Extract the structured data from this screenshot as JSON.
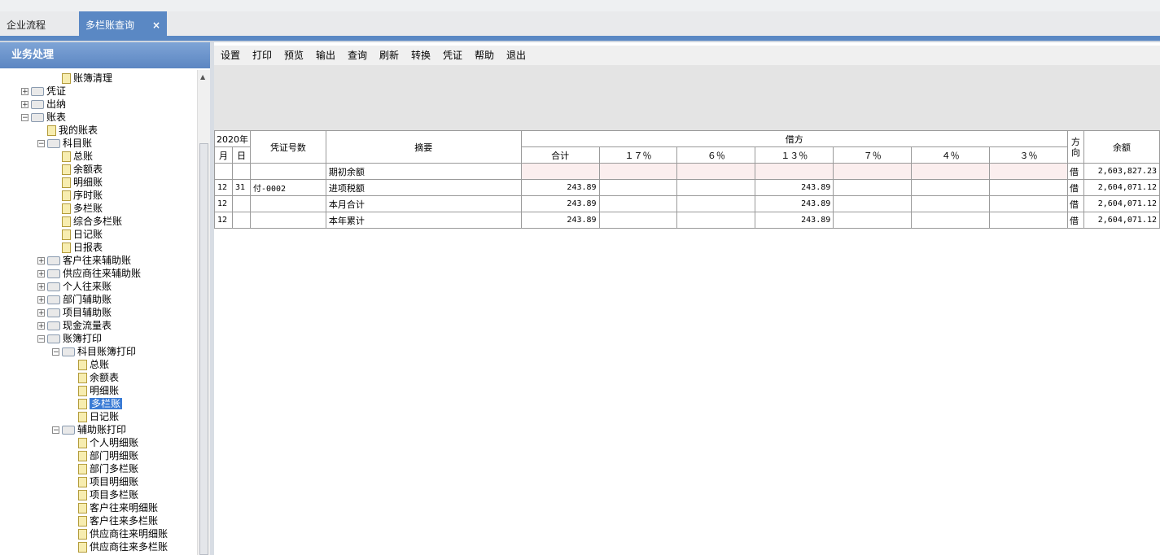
{
  "tabs": [
    {
      "label": "企业流程",
      "active": false
    },
    {
      "label": "多栏账查询",
      "active": true,
      "close": "×"
    }
  ],
  "left_panel": {
    "title": "业务处理",
    "tree": [
      {
        "label": "账簿清理",
        "type": "doc",
        "level": 3
      },
      {
        "label": "凭证",
        "type": "folder",
        "level": 1,
        "expander": "+"
      },
      {
        "label": "出纳",
        "type": "folder",
        "level": 1,
        "expander": "+"
      },
      {
        "label": "账表",
        "type": "folder",
        "level": 1,
        "expander": "−"
      },
      {
        "label": "我的账表",
        "type": "doc",
        "level": 2
      },
      {
        "label": "科目账",
        "type": "folder",
        "level": 2,
        "expander": "−"
      },
      {
        "label": "总账",
        "type": "doc",
        "level": 3
      },
      {
        "label": "余额表",
        "type": "doc",
        "level": 3
      },
      {
        "label": "明细账",
        "type": "doc",
        "level": 3
      },
      {
        "label": "序时账",
        "type": "doc",
        "level": 3
      },
      {
        "label": "多栏账",
        "type": "doc",
        "level": 3
      },
      {
        "label": "综合多栏账",
        "type": "doc",
        "level": 3
      },
      {
        "label": "日记账",
        "type": "doc",
        "level": 3
      },
      {
        "label": "日报表",
        "type": "doc",
        "level": 3
      },
      {
        "label": "客户往来辅助账",
        "type": "folder",
        "level": 2,
        "expander": "+"
      },
      {
        "label": "供应商往来辅助账",
        "type": "folder",
        "level": 2,
        "expander": "+"
      },
      {
        "label": "个人往来账",
        "type": "folder",
        "level": 2,
        "expander": "+"
      },
      {
        "label": "部门辅助账",
        "type": "folder",
        "level": 2,
        "expander": "+"
      },
      {
        "label": "项目辅助账",
        "type": "folder",
        "level": 2,
        "expander": "+"
      },
      {
        "label": "现金流量表",
        "type": "folder",
        "level": 2,
        "expander": "+"
      },
      {
        "label": "账簿打印",
        "type": "folder",
        "level": 2,
        "expander": "−"
      },
      {
        "label": "科目账簿打印",
        "type": "folder",
        "level": 3,
        "expander": "−"
      },
      {
        "label": "总账",
        "type": "doc",
        "level": 4
      },
      {
        "label": "余额表",
        "type": "doc",
        "level": 4
      },
      {
        "label": "明细账",
        "type": "doc",
        "level": 4
      },
      {
        "label": "多栏账",
        "type": "doc",
        "level": 4,
        "selected": true
      },
      {
        "label": "日记账",
        "type": "doc",
        "level": 4
      },
      {
        "label": "辅助账打印",
        "type": "folder",
        "level": 3,
        "expander": "−"
      },
      {
        "label": "个人明细账",
        "type": "doc",
        "level": 4
      },
      {
        "label": "部门明细账",
        "type": "doc",
        "level": 4
      },
      {
        "label": "部门多栏账",
        "type": "doc",
        "level": 4
      },
      {
        "label": "项目明细账",
        "type": "doc",
        "level": 4
      },
      {
        "label": "项目多栏账",
        "type": "doc",
        "level": 4
      },
      {
        "label": "客户往来明细账",
        "type": "doc",
        "level": 4
      },
      {
        "label": "客户往来多栏账",
        "type": "doc",
        "level": 4
      },
      {
        "label": "供应商往来明细账",
        "type": "doc",
        "level": 4
      },
      {
        "label": "供应商往来多栏账",
        "type": "doc",
        "level": 4
      }
    ]
  },
  "toolbar": [
    "设置",
    "打印",
    "预览",
    "输出",
    "查询",
    "刷新",
    "转换",
    "凭证",
    "帮助",
    "退出"
  ],
  "grid": {
    "year": "2020年",
    "month": "月",
    "day": "日",
    "voucher": "凭证号数",
    "summary": "摘要",
    "debit": "借方",
    "direction": "方向",
    "balance": "余额",
    "subcols": [
      "合计",
      "１７％",
      "６％",
      "１３％",
      "７％",
      "４％",
      "３％"
    ],
    "rows": [
      {
        "m": "",
        "d": "",
        "v": "",
        "s": "期初余额",
        "total": "",
        "c13": "",
        "dir": "借",
        "bal": "2,603,827.23"
      },
      {
        "m": "12",
        "d": "31",
        "v": "付-0002",
        "s": "进项税额",
        "total": "243.89",
        "c13": "243.89",
        "dir": "借",
        "bal": "2,604,071.12"
      },
      {
        "m": "12",
        "d": "",
        "v": "",
        "s": "本月合计",
        "total": "243.89",
        "c13": "243.89",
        "dir": "借",
        "bal": "2,604,071.12"
      },
      {
        "m": "12",
        "d": "",
        "v": "",
        "s": "本年累计",
        "total": "243.89",
        "c13": "243.89",
        "dir": "借",
        "bal": "2,604,071.12"
      }
    ]
  }
}
